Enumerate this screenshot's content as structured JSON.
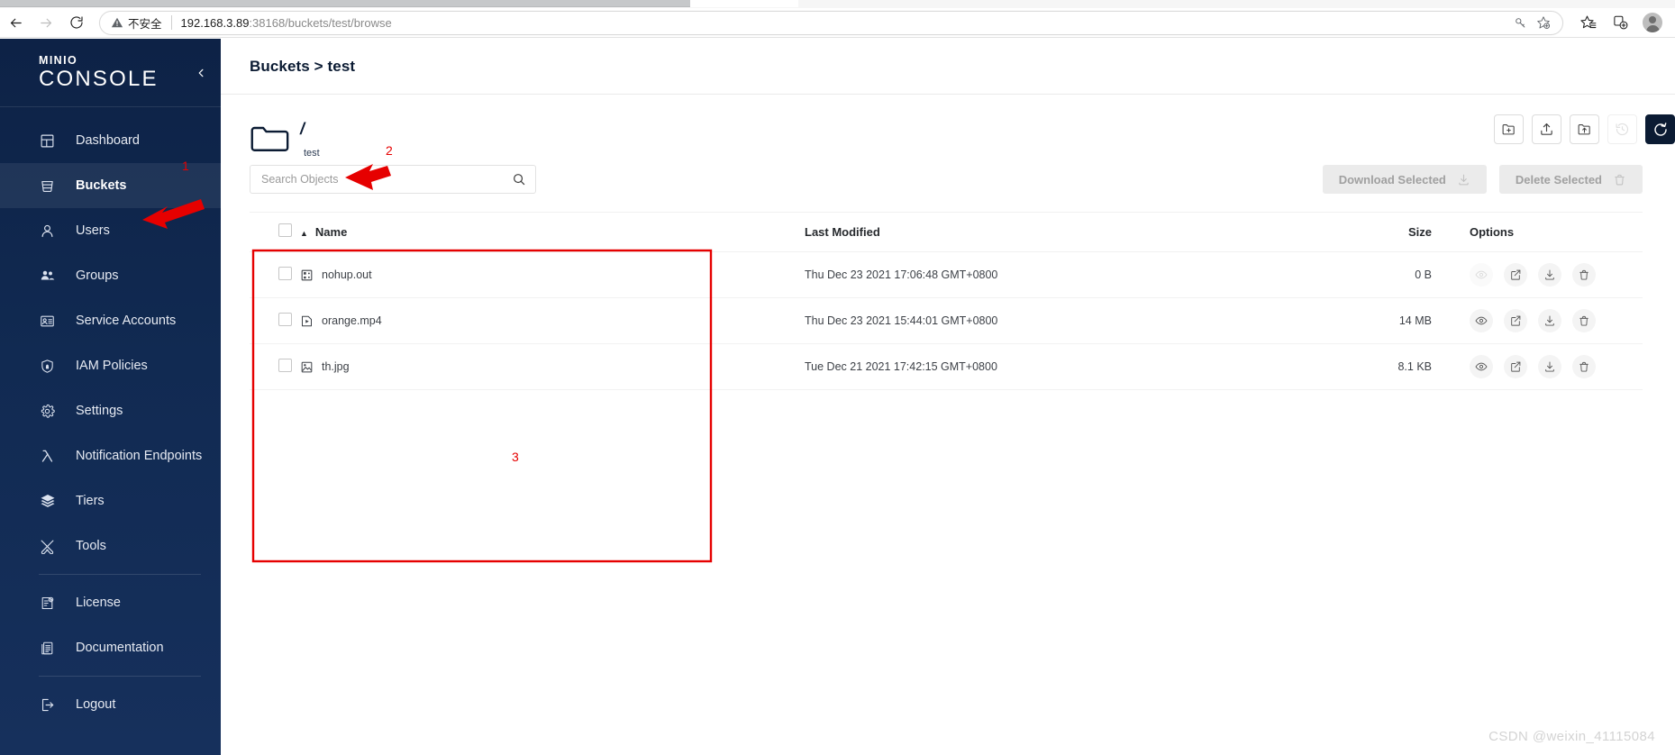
{
  "browser": {
    "back_label": "Back",
    "forward_label": "Forward",
    "reload_label": "Reload",
    "security_label": "不安全",
    "url_host": "192.168.3.89",
    "url_rest": ":38168/buckets/test/browse",
    "omnibox_icons": [
      "password-key-icon",
      "add-favorite-icon"
    ],
    "toolbar_icons": [
      "favorites-icon",
      "collections-icon"
    ],
    "profile_label": "Profile"
  },
  "sidebar": {
    "logo_top": "MINIO",
    "logo_bottom": "CONSOLE",
    "collapse_label": "‹",
    "items": [
      {
        "label": "Dashboard",
        "icon": "dashboard-icon",
        "active": false
      },
      {
        "label": "Buckets",
        "icon": "bucket-icon",
        "active": true
      },
      {
        "label": "Users",
        "icon": "user-icon",
        "active": false
      },
      {
        "label": "Groups",
        "icon": "groups-icon",
        "active": false
      },
      {
        "label": "Service Accounts",
        "icon": "id-card-icon",
        "active": false
      },
      {
        "label": "IAM Policies",
        "icon": "shield-lock-icon",
        "active": false
      },
      {
        "label": "Settings",
        "icon": "gear-icon",
        "active": false
      },
      {
        "label": "Notification Endpoints",
        "icon": "lambda-icon",
        "active": false
      },
      {
        "label": "Tiers",
        "icon": "layers-icon",
        "active": false
      },
      {
        "label": "Tools",
        "icon": "tools-icon",
        "active": false
      },
      {
        "label": "License",
        "icon": "license-icon",
        "active": false
      },
      {
        "label": "Documentation",
        "icon": "document-icon",
        "active": false
      },
      {
        "label": "Logout",
        "icon": "logout-icon",
        "active": false
      }
    ]
  },
  "header": {
    "breadcrumb": "Buckets > test"
  },
  "folder": {
    "path": "/",
    "bucket_name": "test",
    "icon": "folder-icon"
  },
  "search": {
    "placeholder": "Search Objects",
    "value": "",
    "icon": "search-icon"
  },
  "bulk_actions": [
    {
      "label": "Download Selected",
      "icon": "download-icon",
      "disabled": true
    },
    {
      "label": "Delete Selected",
      "icon": "trash-icon",
      "disabled": true
    }
  ],
  "icon_actions": [
    {
      "name": "create-folder-icon",
      "disabled": false,
      "primary": false
    },
    {
      "name": "upload-file-icon",
      "disabled": false,
      "primary": false
    },
    {
      "name": "upload-folder-icon",
      "disabled": false,
      "primary": false
    },
    {
      "name": "history-icon",
      "disabled": true,
      "primary": false
    },
    {
      "name": "refresh-icon",
      "disabled": false,
      "primary": true
    }
  ],
  "table": {
    "columns": [
      "Name",
      "Last Modified",
      "Size",
      "Options"
    ],
    "sort_column": "Name",
    "sort_direction": "asc",
    "select_all_checked": false,
    "rows": [
      {
        "name": "nohup.out",
        "file_icon": "generic-file-icon",
        "last_modified": "Thu Dec 23 2021 17:06:48 GMT+0800",
        "size": "0 B",
        "checked": false,
        "preview_disabled": true
      },
      {
        "name": "orange.mp4",
        "file_icon": "video-file-icon",
        "last_modified": "Thu Dec 23 2021 15:44:01 GMT+0800",
        "size": "14 MB",
        "checked": false,
        "preview_disabled": false
      },
      {
        "name": "th.jpg",
        "file_icon": "image-file-icon",
        "last_modified": "Tue Dec 21 2021 17:42:15 GMT+0800",
        "size": "8.1 KB",
        "checked": false,
        "preview_disabled": false
      }
    ],
    "row_option_icons": [
      "preview-eye-icon",
      "share-icon",
      "download-icon",
      "delete-trash-icon"
    ]
  },
  "annotations": {
    "color": "#e60000",
    "marks": [
      {
        "id": "1",
        "label": "1",
        "target": "sidebar-item-buckets"
      },
      {
        "id": "2",
        "label": "2",
        "target": "folder-row"
      },
      {
        "id": "3",
        "label": "3",
        "target": "objects-table-region"
      }
    ]
  },
  "watermark": {
    "text": "CSDN @weixin_41115084"
  }
}
